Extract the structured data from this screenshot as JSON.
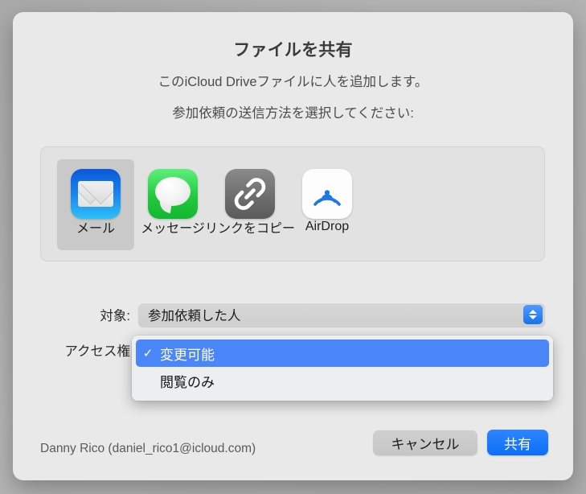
{
  "dialog": {
    "title": "ファイルを共有",
    "subtitle_1": "このiCloud Driveファイルに人を追加します。",
    "subtitle_2": "参加依頼の送信方法を選択してください:"
  },
  "share_methods": {
    "items": [
      {
        "label": "メール",
        "icon": "mail-icon",
        "selected": true
      },
      {
        "label": "メッセージ",
        "icon": "messages-icon",
        "selected": false
      },
      {
        "label": "リンクをコピー",
        "icon": "link-icon",
        "selected": false
      },
      {
        "label": "AirDrop",
        "icon": "airdrop-icon",
        "selected": false
      }
    ]
  },
  "fields": {
    "target": {
      "label": "対象:",
      "value": "参加依頼した人"
    },
    "access": {
      "label": "アクセス権",
      "value": "変更可能"
    }
  },
  "popup_menu": {
    "options": [
      {
        "label": "変更可能",
        "checked": true,
        "highlighted": true
      },
      {
        "label": "閲覧のみ",
        "checked": false,
        "highlighted": false
      }
    ],
    "checkmark": "✓"
  },
  "footer": {
    "account": "Danny Rico (daniel_rico1@icloud.com)",
    "cancel_label": "キャンセル",
    "share_label": "共有"
  },
  "colors": {
    "accent_blue": "#1a7aff",
    "menu_highlight": "#4a86f7",
    "dialog_bg": "#e9e9e9",
    "panel_bg": "#e2e2e2",
    "selected_tile": "#c9c9c9"
  }
}
